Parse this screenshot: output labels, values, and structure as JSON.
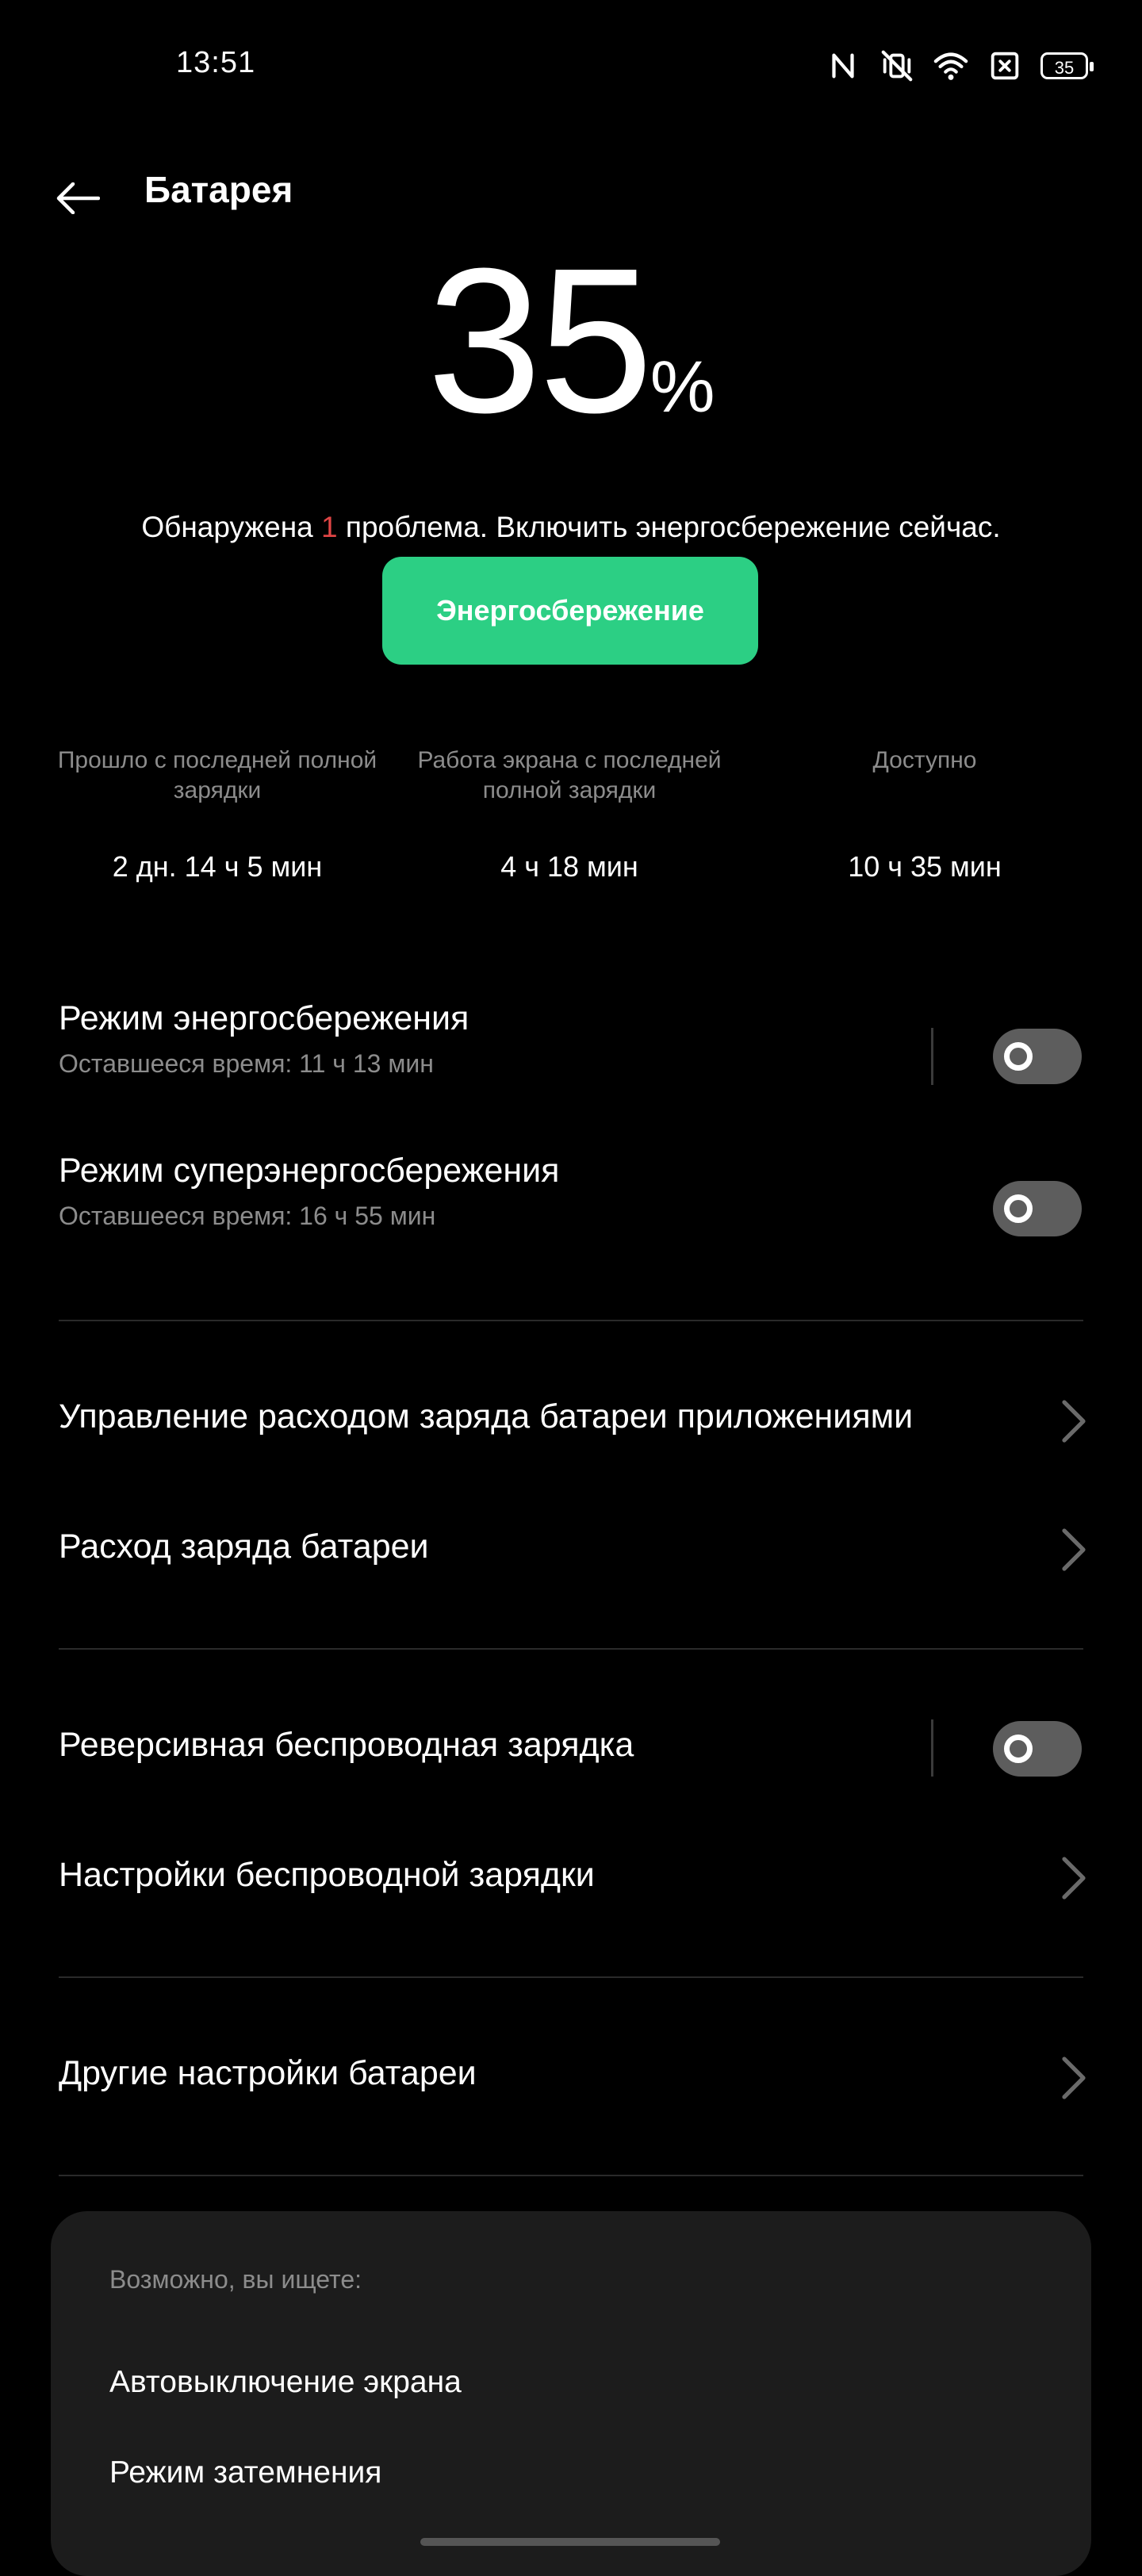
{
  "status_bar": {
    "time": "13:51",
    "battery_level": "35",
    "icons": [
      "nfc-icon",
      "vibrate-mute-icon",
      "wifi-icon",
      "no-sim-icon",
      "battery-icon"
    ]
  },
  "header": {
    "title": "Батарея"
  },
  "battery": {
    "percent": "35",
    "percent_sign": "%"
  },
  "alert": {
    "prefix": "Обнаружена ",
    "count": "1",
    "suffix": " проблема. Включить энергосбережение сейчас.",
    "button_label": "Энергосбережение"
  },
  "stats": [
    {
      "label": "Прошло с последней полной зарядки",
      "value": "2 дн. 14 ч 5 мин"
    },
    {
      "label": "Работа экрана с последней полной зарядки",
      "value": "4 ч 18 мин"
    },
    {
      "label": "Доступно",
      "value": "10 ч 35 мин"
    }
  ],
  "modes": [
    {
      "title": "Режим энергосбережения",
      "subtitle": "Оставшееся время:  11 ч 13 мин",
      "enabled": false
    },
    {
      "title": "Режим суперэнергосбережения",
      "subtitle": "Оставшееся время:  16 ч 55 мин",
      "enabled": false
    }
  ],
  "links": [
    {
      "title": "Управление расходом заряда батареи приложениями"
    },
    {
      "title": "Расход заряда батареи"
    }
  ],
  "wireless": {
    "reverse": {
      "title": "Реверсивная беспроводная зарядка",
      "enabled": false
    },
    "settings": {
      "title": "Настройки беспроводной зарядки"
    }
  },
  "other": {
    "title": "Другие настройки батареи"
  },
  "suggestions": {
    "heading": "Возможно, вы ищете:",
    "items": [
      "Автовыключение экрана",
      "Режим затемнения"
    ]
  },
  "colors": {
    "accent": "#2ccf84",
    "alert": "#e04545",
    "toggle_off": "#5d5d5d",
    "secondary_text": "#8c8c8c"
  }
}
